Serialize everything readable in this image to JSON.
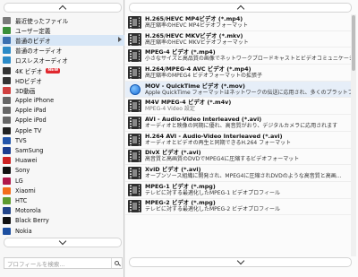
{
  "categories": [
    {
      "label": "最近使ったファイル",
      "icon": "history-icon",
      "color": "#7a7a7a"
    },
    {
      "label": "ユーザー定義",
      "icon": "user-icon",
      "color": "#3a8f3a"
    },
    {
      "label": "普通のビデオ",
      "icon": "video-icon",
      "color": "#3a6fb0",
      "selected": true
    },
    {
      "label": "普通のオーディオ",
      "icon": "audio-icon",
      "color": "#2b8ac7"
    },
    {
      "label": "ロスレスオーディオ",
      "icon": "lossless-audio-icon",
      "color": "#2b8ac7"
    },
    {
      "label": "4K ビデオ",
      "icon": "4k-icon",
      "color": "#333333",
      "badge": "NEW"
    },
    {
      "label": "HDビデオ",
      "icon": "hd-icon",
      "color": "#333333"
    },
    {
      "label": "3D動画",
      "icon": "3d-icon",
      "color": "#d04040"
    },
    {
      "label": "Apple iPhone",
      "icon": "iphone-icon",
      "color": "#666666"
    },
    {
      "label": "Apple iPad",
      "icon": "ipad-icon",
      "color": "#666666"
    },
    {
      "label": "Apple iPod",
      "icon": "ipod-icon",
      "color": "#666666"
    },
    {
      "label": "Apple TV",
      "icon": "apple-tv-icon",
      "color": "#222222"
    },
    {
      "label": "TVS",
      "icon": "tvs-icon",
      "color": "#2255aa"
    },
    {
      "label": "SamSung",
      "icon": "samsung-icon",
      "color": "#1a3d8f"
    },
    {
      "label": "Huawei",
      "icon": "huawei-icon",
      "color": "#cc2222"
    },
    {
      "label": "Sony",
      "icon": "sony-icon",
      "color": "#111111"
    },
    {
      "label": "LG",
      "icon": "lg-icon",
      "color": "#b0174a"
    },
    {
      "label": "Xiaomi",
      "icon": "xiaomi-icon",
      "color": "#f26c1a"
    },
    {
      "label": "HTC",
      "icon": "htc-icon",
      "color": "#5c9a2e"
    },
    {
      "label": "Motorola",
      "icon": "motorola-icon",
      "color": "#224488"
    },
    {
      "label": "Black Berry",
      "icon": "blackberry-icon",
      "color": "#111111"
    },
    {
      "label": "Nokia",
      "icon": "nokia-icon",
      "color": "#1d4fa0"
    }
  ],
  "search": {
    "placeholder": "プロフィールを検索..."
  },
  "formats": [
    {
      "title": "H.265/HEVC MP4ビデオ (*.mp4)",
      "desc": "高圧縮率のHEVC MP4ビデオフォーマット"
    },
    {
      "title": "H.265/HEVC MKVビデオ (*.mkv)",
      "desc": "高圧縮率のHEVC MKVビデオフォーマット"
    },
    {
      "title": "MPEG-4 ビデオ (*.mp4)",
      "desc": "小さなサイズと高品質の画像でネットワークブロードキャストとビデオコミュニケーションの..."
    },
    {
      "title": "H.264/MPEG-4 AVC ビデオ (*.mp4)",
      "desc": "高圧縮率のMPEG4 ビデオフォーマットの拡張子"
    },
    {
      "title": "MOV - QuickTime ビデオ (*.mov)",
      "desc": "Apple QuickTime フォーマットはネットワークの伝送に応用され、多くのプラットフォーム...",
      "quicktime": true,
      "highlight": true
    },
    {
      "title": "M4V MPEG-4 ビデオ (*.m4v)",
      "desc": "MPEG-4 Video 設定",
      "gray": true
    },
    {
      "title": "AVI - Audio-Video Interleaved (*.avi)",
      "desc": "オーディオと映像の同期に優れ、高音質がおり、デジタルカメラに応用されます"
    },
    {
      "title": "H.264 AVI - Audio-Video Interleaved (*.avi)",
      "desc": "オーディオとビデオの再生と同期できるH.264 フォーマット"
    },
    {
      "title": "DivX ビデオ (*.avi)",
      "desc": "高音質と高画質のDVDでMPEG4に圧縮するビデオフォーマット"
    },
    {
      "title": "XviD ビデオ (*.avi)",
      "desc": "オープンソース組織に開発され、MPEG4に圧縮されDVDのような高音質と高画..."
    },
    {
      "title": "MPEG-1 ビデオ (*.mpg)",
      "desc": "テレビに対する最適化したMPEG-1 ビデオプロフィール"
    },
    {
      "title": "MPEG-2 ビデオ (*.mpg)",
      "desc": "テレビに対する最適化したMPEG-2 ビデオプロフィール"
    }
  ]
}
